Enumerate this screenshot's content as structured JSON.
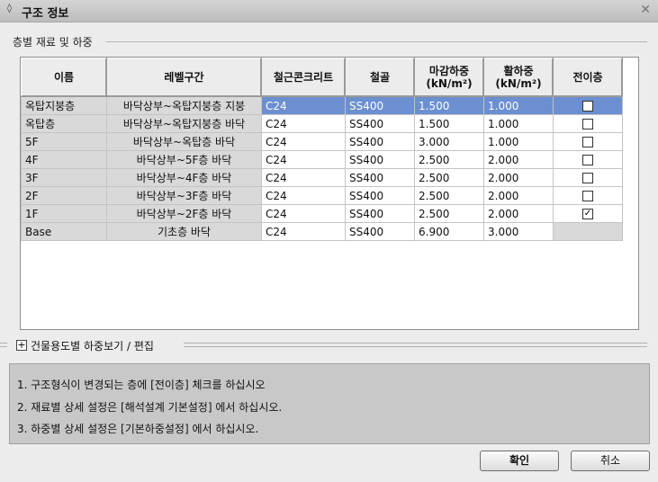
{
  "window": {
    "title": "구조 정보"
  },
  "group": {
    "title": "층별 재료 및 하중"
  },
  "grid": {
    "headers": {
      "name": "이름",
      "level": "레벨구간",
      "concrete": "철근콘크리트",
      "steel": "철골",
      "finish_load_1": "마감하중",
      "finish_load_2": "(kN/m²)",
      "live_load_1": "활하중",
      "live_load_2": "(kN/m²)",
      "transfer": "전이층"
    },
    "rows": [
      {
        "name": "옥탑지붕층",
        "level": "바닥상부~옥탑지붕층 지붕",
        "concrete": "C24",
        "steel": "SS400",
        "finish": "1.500",
        "live": "1.000",
        "transfer": ""
      },
      {
        "name": "옥탑층",
        "level": "바닥상부~옥탑지붕층 바닥",
        "concrete": "C24",
        "steel": "SS400",
        "finish": "1.500",
        "live": "1.000",
        "transfer": ""
      },
      {
        "name": "5F",
        "level": "바닥상부~옥탑층 바닥",
        "concrete": "C24",
        "steel": "SS400",
        "finish": "3.000",
        "live": "1.000",
        "transfer": ""
      },
      {
        "name": "4F",
        "level": "바닥상부~5F층 바닥",
        "concrete": "C24",
        "steel": "SS400",
        "finish": "2.500",
        "live": "2.000",
        "transfer": ""
      },
      {
        "name": "3F",
        "level": "바닥상부~4F층 바닥",
        "concrete": "C24",
        "steel": "SS400",
        "finish": "2.500",
        "live": "2.000",
        "transfer": ""
      },
      {
        "name": "2F",
        "level": "바닥상부~3F층 바닥",
        "concrete": "C24",
        "steel": "SS400",
        "finish": "2.500",
        "live": "2.000",
        "transfer": ""
      },
      {
        "name": "1F",
        "level": "바닥상부~2F층 바닥",
        "concrete": "C24",
        "steel": "SS400",
        "finish": "2.500",
        "live": "2.000",
        "transfer": "✓"
      },
      {
        "name": "Base",
        "level": "기초층 바닥",
        "concrete": "C24",
        "steel": "SS400",
        "finish": "6.900",
        "live": "3.000",
        "transfer": ""
      }
    ]
  },
  "expander": {
    "icon": "⊞",
    "label": "건물용도별 하중보기 / 편집"
  },
  "notes": [
    "1. 구조형식이 변경되는 층에 [전이층] 체크를 하십시오",
    "2. 재료별 상세 설정은 [해석설계 기본설정] 에서 하십시오.",
    "3. 하중별 상세 설정은 [기본하중설정] 에서 하십시오."
  ],
  "buttons": {
    "ok": "확인",
    "cancel": "취소"
  },
  "colors": {
    "selected_row": "#6b8fd1",
    "selected_cell": "#2b3f86"
  }
}
